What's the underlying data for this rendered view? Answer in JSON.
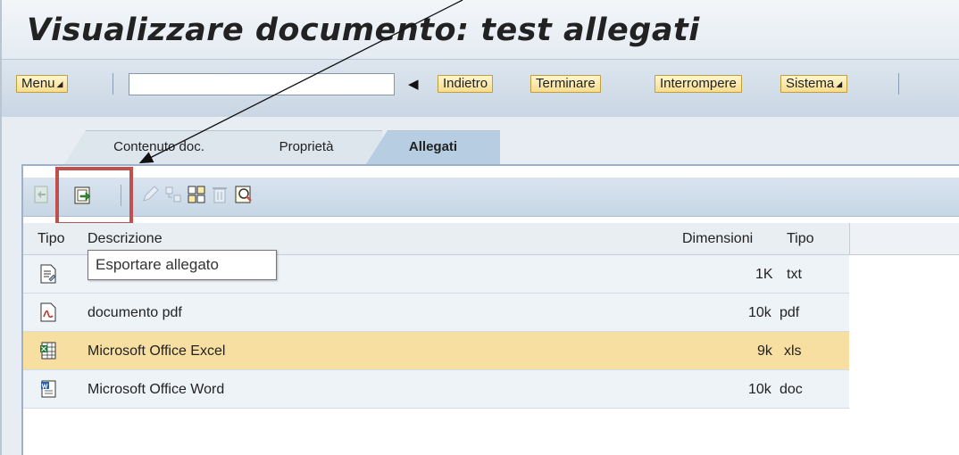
{
  "window": {
    "title": "Visualizzare documento: test allegati"
  },
  "toolbar": {
    "menu_label": "Menu",
    "command_value": "",
    "back_label": "Indietro",
    "exit_label": "Terminare",
    "cancel_label": "Interrompere",
    "system_label": "Sistema"
  },
  "tabs": [
    {
      "label": "Contenuto doc.",
      "active": false
    },
    {
      "label": "Proprietà",
      "active": false
    },
    {
      "label": "Allegati",
      "active": true
    }
  ],
  "attachments_toolbar": {
    "buttons": [
      "refresh-icon",
      "export-icon",
      "edit-icon",
      "move-icon",
      "insert-icon",
      "delete-icon",
      "search-icon"
    ],
    "highlight_color": "#c0504d"
  },
  "table": {
    "columns": [
      "Tipo",
      "Descrizione",
      "Dimensioni",
      "Tipo"
    ],
    "rows": [
      {
        "icon": "text-file-icon",
        "description": "",
        "size": "1K",
        "type": "txt",
        "selected": false
      },
      {
        "icon": "pdf-file-icon",
        "description": "documento pdf",
        "size": "10k",
        "type": "pdf",
        "selected": false
      },
      {
        "icon": "excel-file-icon",
        "description": "Microsoft Office Excel",
        "size": "9k",
        "type": "xls",
        "selected": true
      },
      {
        "icon": "word-file-icon",
        "description": "Microsoft Office Word",
        "size": "10k",
        "type": "doc",
        "selected": false
      }
    ]
  },
  "tooltip": {
    "text": "Esportare allegato"
  },
  "colors": {
    "selected_row": "#f6dfa1",
    "button": "#f6dc8f",
    "header": "#c9d6e3"
  }
}
